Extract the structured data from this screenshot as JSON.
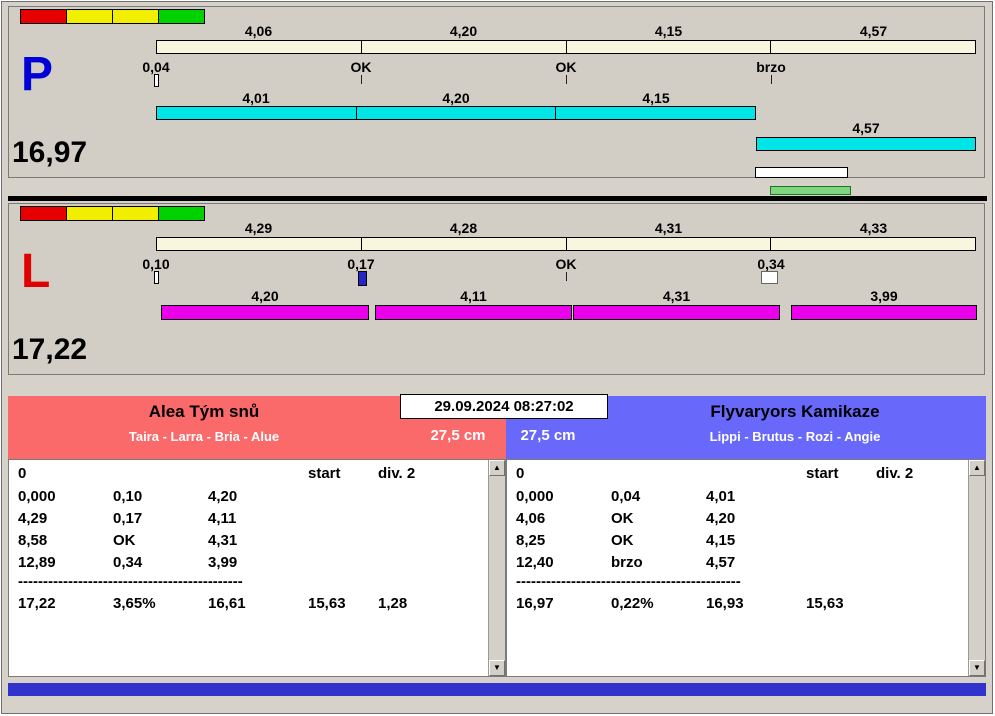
{
  "colors": {
    "accent_red_header": "#fa6a6a",
    "accent_blue_header": "#6868fa",
    "lane_p_letter": "#0202d6",
    "lane_l_letter": "#e00202",
    "split_bar_cream": "#f9f6de",
    "run_bar_cyan": "#00e6e6",
    "run_bar_magenta": "#ea00ea",
    "light_red": "#e60000",
    "light_yellow": "#f2ee00",
    "light_green": "#00d200",
    "bottom_strip_blue": "#3232cc"
  },
  "icons": {
    "scroll_up": "▲",
    "scroll_down": "▼"
  },
  "datetime": "29.09.2024 08:27:02",
  "lanes": {
    "p": {
      "letter": "P",
      "total": "16,97",
      "splits": [
        "4,06",
        "4,20",
        "4,15",
        "4,57"
      ],
      "marks": [
        "0,04",
        "OK",
        "OK",
        "brzo"
      ],
      "run_splits": [
        "4,01",
        "4,20",
        "4,15"
      ],
      "late_split": "4,57"
    },
    "l": {
      "letter": "L",
      "total": "17,22",
      "splits": [
        "4,29",
        "4,28",
        "4,31",
        "4,33"
      ],
      "marks": [
        "0,10",
        "0,17",
        "OK",
        "0,34"
      ],
      "run_splits": [
        "4,20",
        "4,11",
        "4,31",
        "3,99"
      ]
    }
  },
  "teams": {
    "left": {
      "name": "Alea Tým snů",
      "dogs": "Taira - Larra - Bria - Alue",
      "height": "27,5 cm",
      "head": [
        "0",
        "start",
        "div. 2"
      ],
      "rows": [
        [
          "0,000",
          "0,10",
          "4,20"
        ],
        [
          "4,29",
          "0,17",
          "4,11"
        ],
        [
          "8,58",
          "OK",
          "4,31"
        ],
        [
          "12,89",
          "0,34",
          "3,99"
        ]
      ],
      "divider": "---------------------------------------------",
      "totals": [
        "17,22",
        "3,65%",
        "16,61",
        "15,63",
        "1,28"
      ]
    },
    "right": {
      "name": "Flyvaryors Kamikaze",
      "dogs": "Lippi - Brutus - Rozi - Angie",
      "height": "27,5 cm",
      "head": [
        "0",
        "start",
        "div. 2"
      ],
      "rows": [
        [
          "0,000",
          "0,04",
          "4,01"
        ],
        [
          "4,06",
          "OK",
          "4,20"
        ],
        [
          "8,25",
          "OK",
          "4,15"
        ],
        [
          "12,40",
          "brzo",
          "4,57"
        ]
      ],
      "divider": "---------------------------------------------",
      "totals": [
        "16,97",
        "0,22%",
        "16,93",
        "15,63"
      ]
    }
  }
}
